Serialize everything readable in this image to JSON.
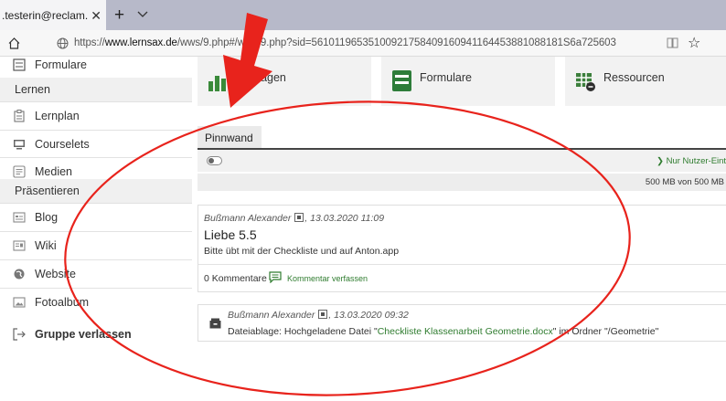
{
  "browser": {
    "tab_title": ".testerin@reclam.l",
    "tab_close": "✕",
    "new_tab": "+",
    "url_prefix": "https://",
    "url_host": "www.lernsax.de",
    "url_rest": "/wws/9.php#/wws/9.php?sid=56101196535100921758409160941164453881088181S6a725603",
    "star": "☆"
  },
  "sidebar": {
    "top_item": "Formulare",
    "section_learn": "Lernen",
    "learn_items": [
      "Lernplan",
      "Courselets",
      "Medien"
    ],
    "section_present": "Präsentieren",
    "present_items": [
      "Blog",
      "Wiki",
      "Website",
      "Fotoalbum"
    ],
    "leave_group": "Gruppe verlassen"
  },
  "tiles": [
    {
      "label": "Umfragen"
    },
    {
      "label": "Formulare"
    },
    {
      "label": "Ressourcen"
    }
  ],
  "pinnwand": {
    "tab_label": "Pinnwand",
    "filter_label": "❯ Nur Nutzer-Eint",
    "storage": "500 MB von 500 MB"
  },
  "post": {
    "author": "Bußmann Alexander",
    "date": ", 13.03.2020 11:09",
    "title": "Liebe 5.5",
    "body": "Bitte übt mit der Checkliste und auf Anton.app",
    "comments": "0 Kommentare",
    "comment_link": "Kommentar verfassen"
  },
  "upload": {
    "author": "Bußmann Alexander",
    "date": ", 13.03.2020 09:32",
    "prefix": "Dateiablage: Hochgeladene Datei \"",
    "filename": "Checkliste Klassenarbeit Geometrie.docx",
    "suffix": "\" im Ordner \"/Geometrie\""
  },
  "colors": {
    "accent_green": "#2f7c2f",
    "annotation_red": "#e8231c"
  }
}
